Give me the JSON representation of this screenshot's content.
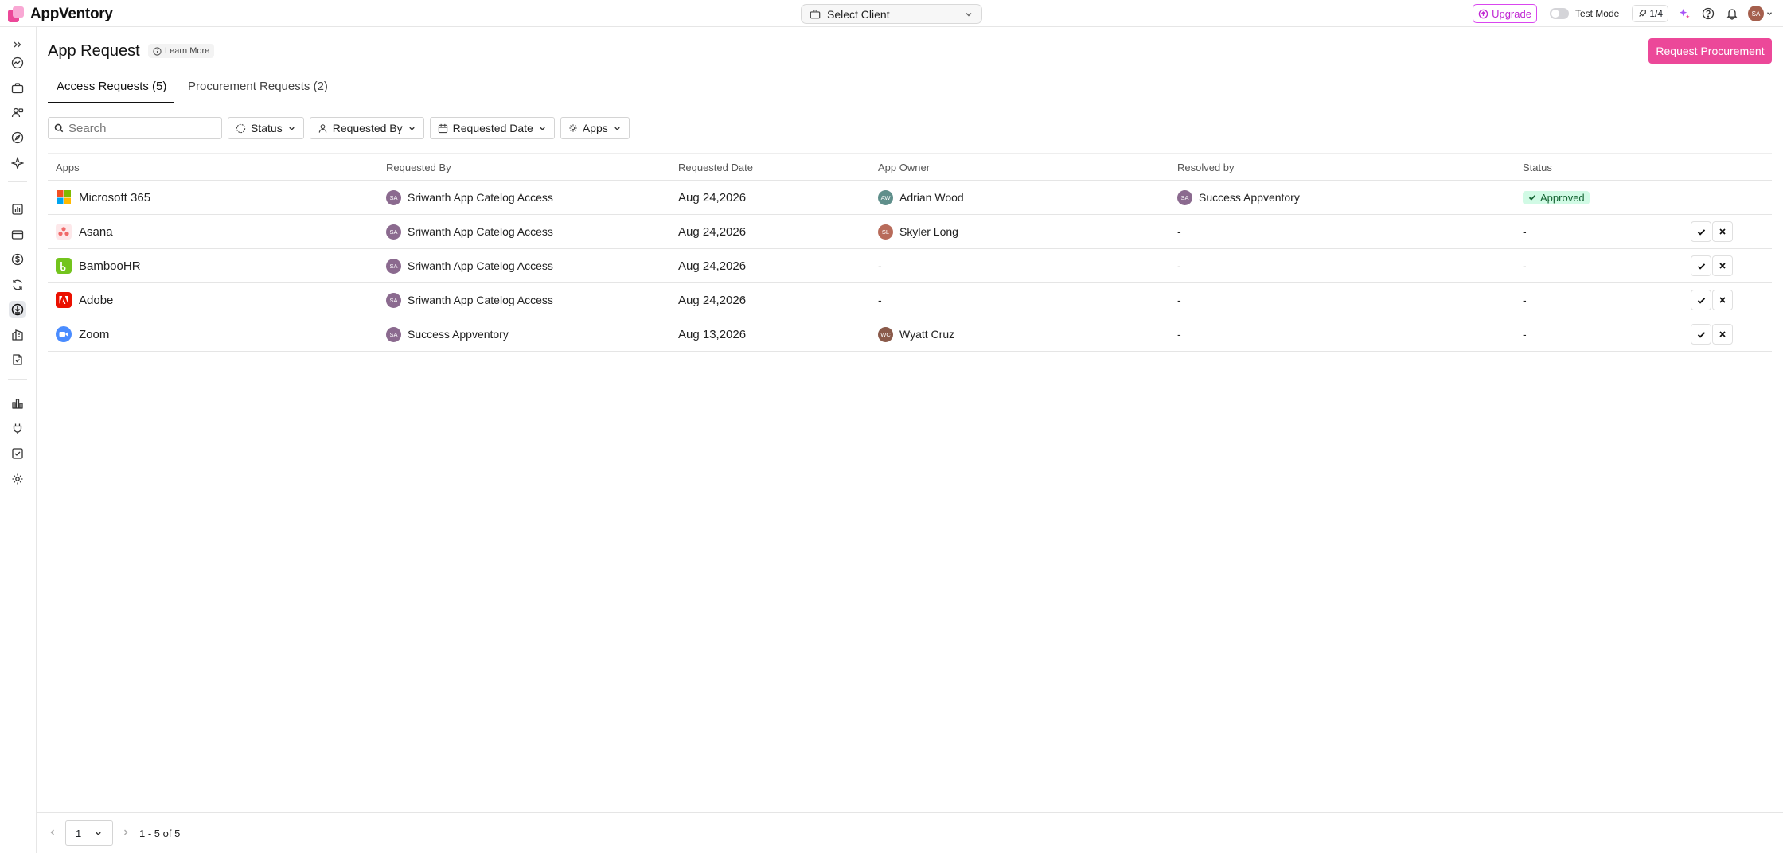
{
  "app": {
    "name": "AppVentory",
    "client_select_label": "Select Client",
    "upgrade_label": "Upgrade",
    "test_mode_label": "Test Mode",
    "counter_label": "1/4",
    "user_initials": "SA",
    "accent_color": "#ec4899"
  },
  "sidebar": {
    "items": [
      {
        "icon": "expand-icon"
      },
      {
        "icon": "dashboard-icon"
      },
      {
        "icon": "briefcase-icon"
      },
      {
        "icon": "users-icon"
      },
      {
        "icon": "compass-icon"
      },
      {
        "icon": "sparkle-icon"
      },
      {
        "icon": "reports-icon"
      },
      {
        "icon": "card-icon"
      },
      {
        "icon": "dollar-icon"
      },
      {
        "icon": "renewal-icon"
      },
      {
        "icon": "app-request-icon",
        "active": true
      },
      {
        "icon": "building-icon"
      },
      {
        "icon": "document-icon"
      },
      {
        "icon": "integrations-icon"
      },
      {
        "icon": "plug-icon"
      },
      {
        "icon": "tasks-icon"
      },
      {
        "icon": "settings-icon"
      }
    ]
  },
  "header": {
    "title": "App Request",
    "learn_more": "Learn More",
    "primary_action": "Request Procurement"
  },
  "tabs": [
    {
      "label": "Access Requests (5)",
      "active": true
    },
    {
      "label": "Procurement Requests (2)",
      "active": false
    }
  ],
  "filters": {
    "search_placeholder": "Search",
    "status": "Status",
    "requested_by": "Requested By",
    "requested_date": "Requested Date",
    "apps": "Apps"
  },
  "table": {
    "columns": [
      "Apps",
      "Requested By",
      "Requested Date",
      "App Owner",
      "Resolved by",
      "Status"
    ],
    "rows": [
      {
        "app": "Microsoft 365",
        "app_icon": "microsoft-365-icon",
        "requested_by": "Sriwanth App Catelog Access",
        "requested_by_initials": "SA",
        "date": "Aug 24,2026",
        "owner": "Adrian Wood",
        "owner_initials": "AW",
        "owner_color": "#5f8f8b",
        "resolved_by": "Success Appventory",
        "resolved_initials": "SA",
        "status": "Approved",
        "has_actions": false
      },
      {
        "app": "Asana",
        "app_icon": "asana-icon",
        "requested_by": "Sriwanth App Catelog Access",
        "requested_by_initials": "SA",
        "date": "Aug 24,2026",
        "owner": "Skyler Long",
        "owner_initials": "SL",
        "owner_color": "#b86b5a",
        "resolved_by": "-",
        "status": "-",
        "has_actions": true
      },
      {
        "app": "BambooHR",
        "app_icon": "bamboohr-icon",
        "requested_by": "Sriwanth App Catelog Access",
        "requested_by_initials": "SA",
        "date": "Aug 24,2026",
        "owner": "-",
        "resolved_by": "-",
        "status": "-",
        "has_actions": true
      },
      {
        "app": "Adobe",
        "app_icon": "adobe-icon",
        "requested_by": "Sriwanth App Catelog Access",
        "requested_by_initials": "SA",
        "date": "Aug 24,2026",
        "owner": "-",
        "resolved_by": "-",
        "status": "-",
        "has_actions": true
      },
      {
        "app": "Zoom",
        "app_icon": "zoom-icon",
        "requested_by": "Success Appventory",
        "requested_by_initials": "SA",
        "date": "Aug 13,2026",
        "owner": "Wyatt Cruz",
        "owner_initials": "WC",
        "owner_color": "#8a5a4a",
        "resolved_by": "-",
        "status": "-",
        "has_actions": true
      }
    ]
  },
  "pagination": {
    "page": "1",
    "info": "1 - 5 of 5"
  }
}
